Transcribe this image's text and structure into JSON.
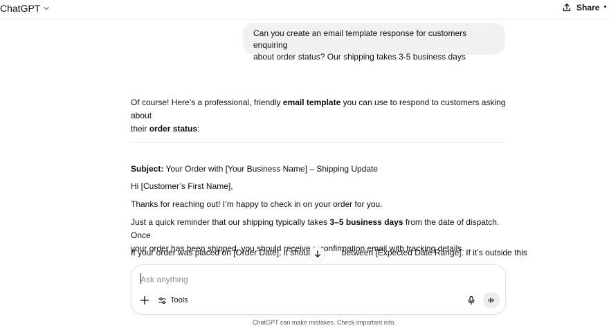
{
  "header": {
    "app_title": "ChatGPT",
    "share_label": "Share"
  },
  "user_message": {
    "line1": "Can you create an email template response for customers enquiring",
    "line2": "about order status? Our shipping takes 3-5 business days"
  },
  "assistant": {
    "intro_line1_a": "Of course! Here’s a professional, friendly ",
    "intro_line1_bold": "email template",
    "intro_line1_b": " you can use to respond to customers asking about",
    "intro_line2_a": "their ",
    "intro_line2_bold": "order status",
    "intro_line2_b": ":",
    "subject_label": "Subject:",
    "subject_text": " Your Order with [Your Business Name] – Shipping Update",
    "greeting": "Hi [Customer’s First Name],",
    "thanks": "Thanks for reaching out! I’m happy to check in on your order for you.",
    "reminder_a": "Just a quick reminder that our shipping typically takes ",
    "reminder_bold": "3–5 business days",
    "reminder_b": " from the date of dispatch. Once",
    "reminder_line2": "your order has been shipped, you should receive a confirmation email with tracking details.",
    "placed_a": "If your order was placed on [Order Date], it should ar",
    "placed_b": " between [Expected Date Range]. If it’s outside this"
  },
  "composer": {
    "placeholder": "Ask anything",
    "tools_label": "Tools"
  },
  "disclaimer": "ChatGPT can make mistakes. Check important info.",
  "colors": {
    "bubble": "#f1f1f1",
    "text": "#0d0d0d",
    "muted": "#5d5d5d",
    "voice_button": "#ececec"
  },
  "icons": {
    "title_dropdown": "chevron-down-icon",
    "share": "share-icon",
    "more": "more-icon",
    "scroll": "arrow-down-icon",
    "add": "plus-icon",
    "tools": "sliders-icon",
    "mic": "microphone-icon",
    "voice": "voice-mode-icon"
  }
}
